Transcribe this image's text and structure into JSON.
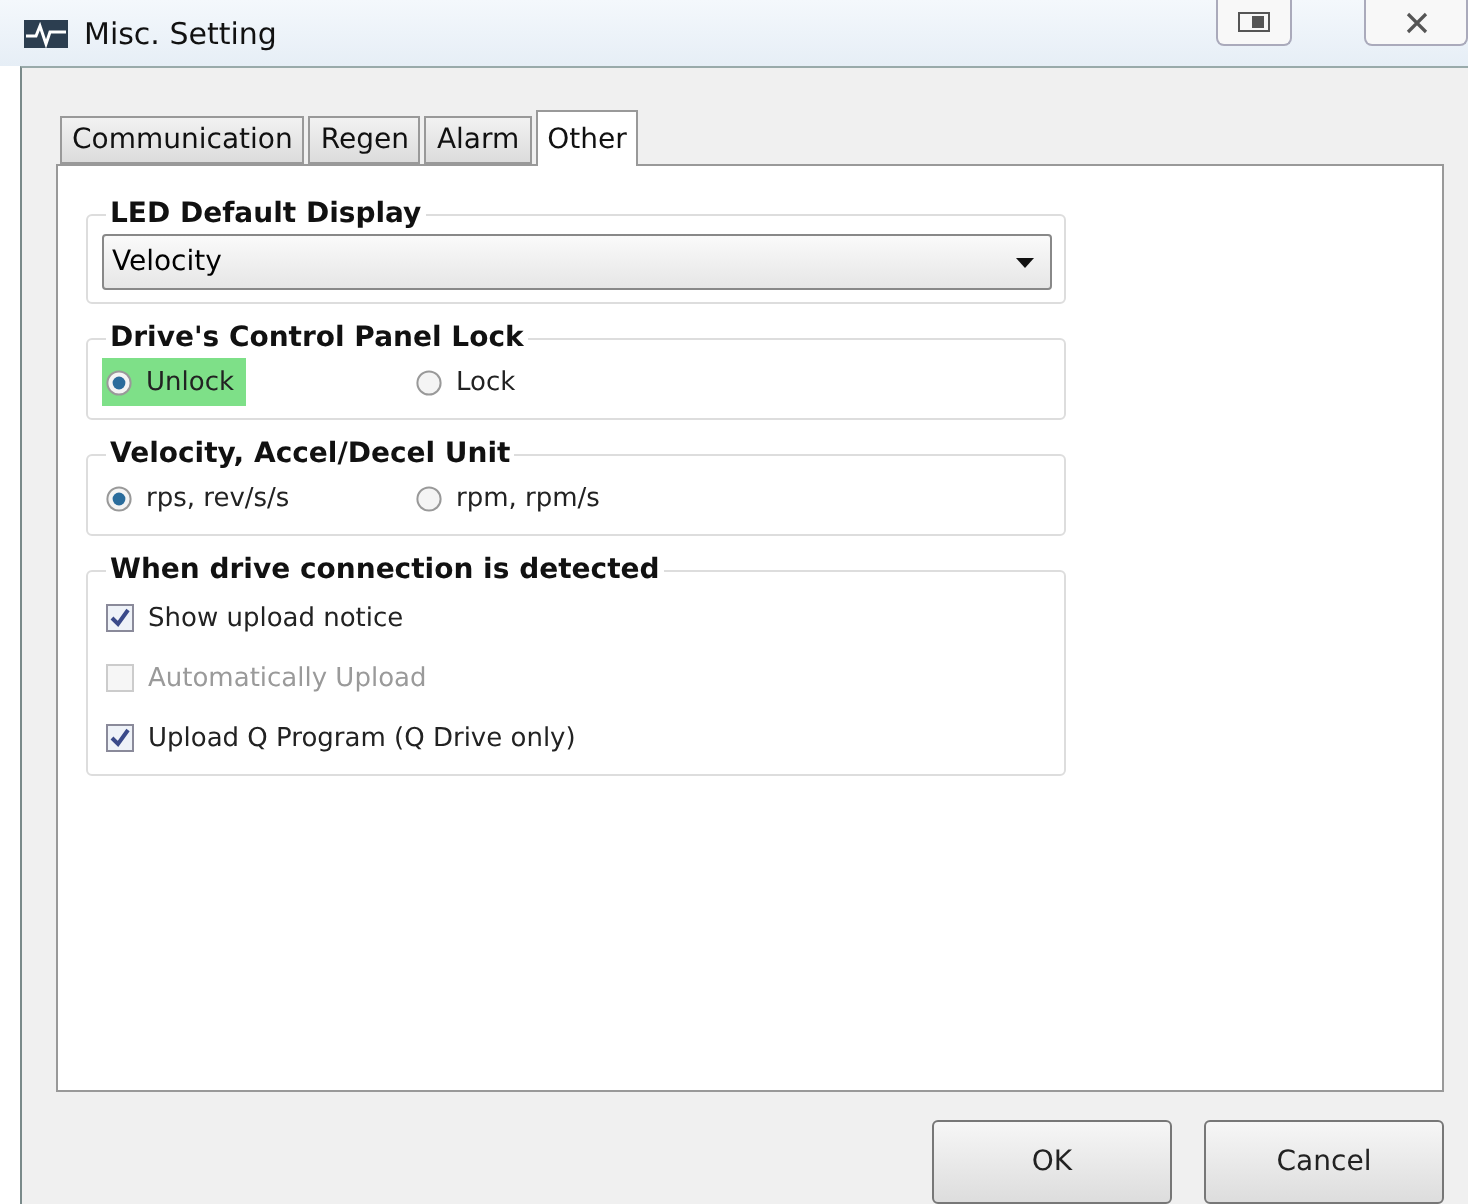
{
  "window": {
    "title": "Misc. Setting"
  },
  "tabs": [
    {
      "label": "Communication",
      "selected": false
    },
    {
      "label": "Regen",
      "selected": false
    },
    {
      "label": "Alarm",
      "selected": false
    },
    {
      "label": "Other",
      "selected": true
    }
  ],
  "groups": [
    {
      "title": "LED Default Display",
      "kind": "dropdown",
      "value": "Velocity"
    },
    {
      "title": "Drive's Control Panel Lock",
      "kind": "radio",
      "options": [
        {
          "label": "Unlock",
          "selected": true,
          "highlighted": true
        },
        {
          "label": "Lock",
          "selected": false,
          "highlighted": false
        }
      ]
    },
    {
      "title": "Velocity, Accel/Decel Unit",
      "kind": "radio",
      "options": [
        {
          "label": "rps, rev/s/s",
          "selected": true,
          "highlighted": false
        },
        {
          "label": "rpm, rpm/s",
          "selected": false,
          "highlighted": false
        }
      ]
    },
    {
      "title": "When drive connection is detected",
      "kind": "checkbox",
      "options": [
        {
          "label": "Show upload notice",
          "checked": true,
          "disabled": false
        },
        {
          "label": "Automatically Upload",
          "checked": false,
          "disabled": true
        },
        {
          "label": "Upload Q Program (Q Drive only)",
          "checked": true,
          "disabled": false
        }
      ]
    }
  ],
  "buttons": [
    "OK",
    "Cancel"
  ]
}
